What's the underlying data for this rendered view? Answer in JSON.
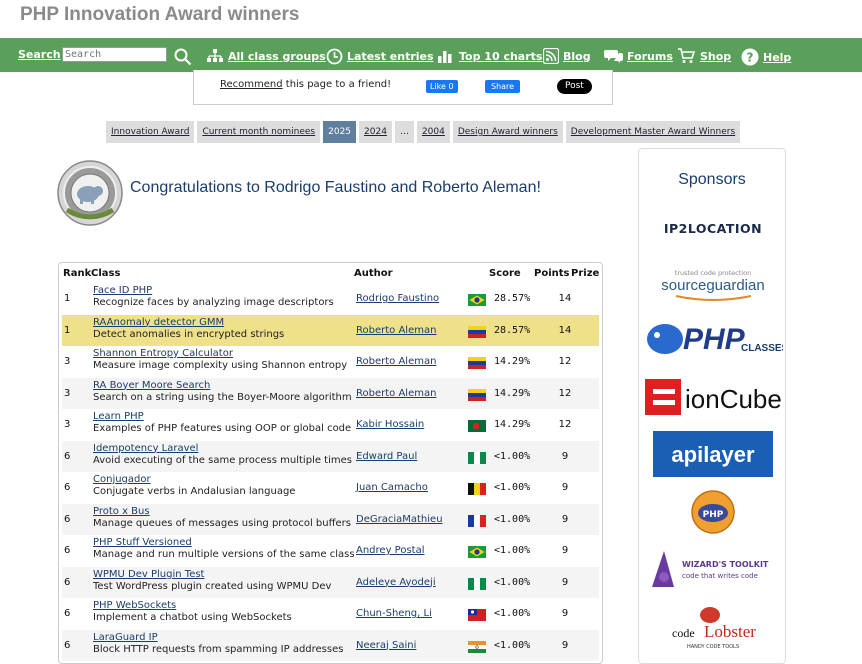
{
  "page": {
    "title": "PHP Innovation Award winners"
  },
  "nav": {
    "search_label": "Search",
    "search_placeholder": "Search",
    "items": [
      {
        "label": "All class groups",
        "icon": "sitemap-icon"
      },
      {
        "label": "Latest entries",
        "icon": "clock-icon"
      },
      {
        "label": "Top 10 charts",
        "icon": "bar-chart-icon"
      },
      {
        "label": "Blog",
        "icon": "rss-icon"
      },
      {
        "label": "Forums",
        "icon": "chat-icon"
      },
      {
        "label": "Shop",
        "icon": "cart-icon"
      },
      {
        "label": "Help",
        "icon": "help-icon"
      }
    ]
  },
  "share": {
    "recommend_link": "Recommend",
    "recommend_text": " this page to a friend!",
    "fb_like": "Like 0",
    "fb_share": "Share",
    "x_post": "Post"
  },
  "tabs": [
    {
      "label": "Innovation Award",
      "active": false
    },
    {
      "label": "Current month nominees",
      "active": false
    },
    {
      "label": "2025",
      "active": true
    },
    {
      "label": "2024",
      "active": false
    },
    {
      "label": "…",
      "active": false
    },
    {
      "label": "2004",
      "active": false
    },
    {
      "label": "Design Award winners",
      "active": false
    },
    {
      "label": "Development Master Award Winners",
      "active": false
    }
  ],
  "congrats": "Congratulations to Rodrigo Faustino and Roberto Aleman!",
  "table": {
    "headers": {
      "rank": "Rank",
      "class": "Class",
      "author": "Author",
      "score": "Score",
      "points": "Points",
      "prize": "Prize"
    },
    "rows": [
      {
        "rank": "1",
        "name": "Face ID PHP",
        "desc": "Recognize faces by analyzing image descriptors",
        "author": "Rodrigo Faustino",
        "flag": "brazil",
        "score": "28.57%",
        "points": "14"
      },
      {
        "rank": "1",
        "name": "RAAnomaly detector GMM",
        "desc": "Detect anomalies in encrypted strings",
        "author": "Roberto Aleman",
        "flag": "venezuela",
        "score": "28.57%",
        "points": "14"
      },
      {
        "rank": "3",
        "name": "Shannon Entropy Calculator",
        "desc": "Measure image complexity using Shannon entropy",
        "author": "Roberto Aleman",
        "flag": "venezuela",
        "score": "14.29%",
        "points": "12"
      },
      {
        "rank": "3",
        "name": "RA Boyer Moore Search",
        "desc": "Search on a string using the Boyer-Moore algorithm",
        "author": "Roberto Aleman",
        "flag": "venezuela",
        "score": "14.29%",
        "points": "12"
      },
      {
        "rank": "3",
        "name": "Learn PHP",
        "desc": "Examples of PHP features using OOP or global code",
        "author": "Kabir Hossain",
        "flag": "bangladesh",
        "score": "14.29%",
        "points": "12"
      },
      {
        "rank": "6",
        "name": "Idempotency Laravel",
        "desc": "Avoid executing of the same process multiple times",
        "author": "Edward Paul",
        "flag": "nigeria",
        "score": "<1.00%",
        "points": "9"
      },
      {
        "rank": "6",
        "name": "Conjugador",
        "desc": "Conjugate verbs in Andalusian language",
        "author": "Juan Camacho",
        "flag": "belgium",
        "score": "<1.00%",
        "points": "9"
      },
      {
        "rank": "6",
        "name": "Proto x Bus",
        "desc": "Manage queues of messages using protocol buffers",
        "author": "DeGraciaMathieu",
        "flag": "france",
        "score": "<1.00%",
        "points": "9"
      },
      {
        "rank": "6",
        "name": "PHP Stuff Versioned",
        "desc": "Manage and run multiple versions of the same class",
        "author": "Andrey Postal",
        "flag": "brazil",
        "score": "<1.00%",
        "points": "9"
      },
      {
        "rank": "6",
        "name": "WPMU Dev Plugin Test",
        "desc": "Test WordPress plugin created using WPMU Dev",
        "author": "Adeleye Ayodeji",
        "flag": "nigeria",
        "score": "<1.00%",
        "points": "9"
      },
      {
        "rank": "6",
        "name": "PHP WebSockets",
        "desc": "Implement a chatbot using WebSockets",
        "author": "Chun-Sheng, Li",
        "flag": "taiwan",
        "score": "<1.00%",
        "points": "9"
      },
      {
        "rank": "6",
        "name": "LaraGuard IP",
        "desc": "Block HTTP requests from spamming IP addresses",
        "author": "Neeraj Saini",
        "flag": "india",
        "score": "<1.00%",
        "points": "9"
      }
    ]
  },
  "sponsors": {
    "title": "Sponsors",
    "logos": [
      {
        "name": "ip2location-logo",
        "text": "IP2LOCATION"
      },
      {
        "name": "sourceguardian-logo",
        "text": "sourceguardian",
        "tagline": "trusted code protection"
      },
      {
        "name": "phpclasses-logo",
        "text": "PHP",
        "suffix": "CLASSES"
      },
      {
        "name": "ioncube-logo",
        "text": "ionCube"
      },
      {
        "name": "apilayer-logo",
        "text": "apilayer"
      },
      {
        "name": "php-award-logo",
        "text": "PHP"
      },
      {
        "name": "wizards-toolkit-logo",
        "text": "WIZARD'S TOOLKIT",
        "tagline": "code that writes code"
      },
      {
        "name": "codelobster-logo",
        "text": "codeLobster",
        "tagline": "HANDY CODE TOOLS"
      }
    ]
  }
}
